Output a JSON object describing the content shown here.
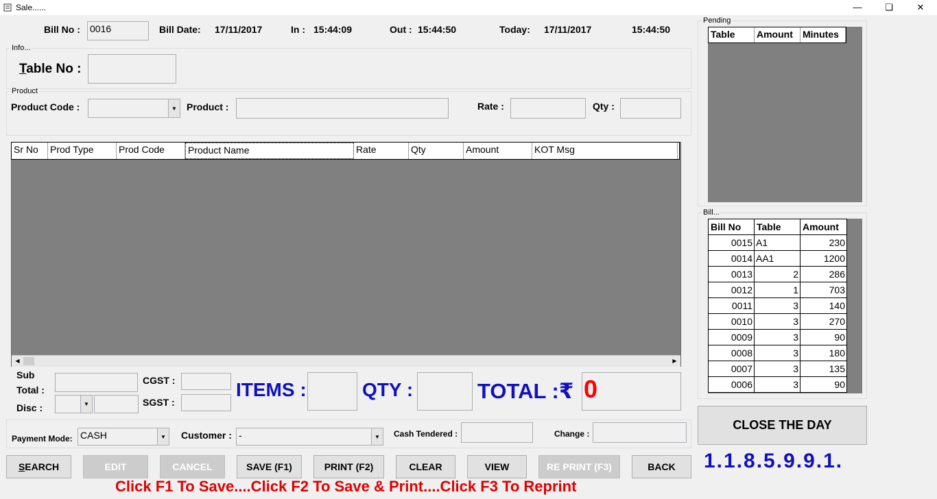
{
  "window": {
    "title": "Sale......",
    "minimize_glyph": "—",
    "restore_glyph": "❏",
    "close_glyph": "✕"
  },
  "header": {
    "bill_no_label": "Bill No :",
    "bill_no_value": "0016",
    "bill_date_label": "Bill Date:",
    "bill_date_value": "17/11/2017",
    "in_label": "In :",
    "in_value": "15:44:09",
    "out_label": "Out :",
    "out_value": "15:44:50",
    "today_label": "Today:",
    "today_value": "17/11/2017",
    "clock_value": "15:44:50"
  },
  "info": {
    "group_label": "Info...",
    "table_no_label": "Table No :",
    "table_no_value": ""
  },
  "product": {
    "group_label": "Product",
    "product_code_label": "Product Code :",
    "product_code_value": "",
    "product_label": "Product :",
    "product_value": "",
    "rate_label": "Rate :",
    "rate_value": "",
    "qty_label": "Qty :",
    "qty_value": ""
  },
  "items_grid": {
    "columns": [
      "Sr No",
      "Prod Type",
      "Prod Code",
      "Product Name",
      "Rate",
      "Qty",
      "Amount",
      "KOT Msg"
    ]
  },
  "totals": {
    "sub_total_label_1": "Sub",
    "sub_total_label_2": "Total :",
    "disc_label": "Disc :",
    "cgst_label": "CGST :",
    "sgst_label": "SGST :",
    "items_label": "ITEMS :",
    "qty_label": "QTY :",
    "total_label": "TOTAL :₹",
    "total_value": "0"
  },
  "payment": {
    "payment_mode_label": "Payment Mode:",
    "payment_mode_value": "CASH",
    "customer_label": "Customer :",
    "customer_value": "-",
    "cash_tendered_label": "Cash Tendered :",
    "change_label": "Change :"
  },
  "buttons": {
    "search": "SEARCH",
    "edit": "EDIT",
    "cancel": "CANCEL",
    "save": "SAVE (F1)",
    "print": "PRINT (F2)",
    "clear": "CLEAR",
    "view": "VIEW",
    "reprint": "RE PRINT (F3)",
    "back": "BACK"
  },
  "hint": "Click F1 To Save....Click F2 To Save & Print....Click F3 To Reprint",
  "pending": {
    "group_label": "Pending",
    "columns": [
      "Table",
      "Amount",
      "Minutes"
    ]
  },
  "bills": {
    "group_label": "Bill...",
    "columns": [
      "Bill No",
      "Table",
      "Amount"
    ],
    "rows": [
      [
        "0015",
        "A1",
        "230"
      ],
      [
        "0014",
        "AA1",
        "1200"
      ],
      [
        "0013",
        "2",
        "286"
      ],
      [
        "0012",
        "1",
        "703"
      ],
      [
        "0011",
        "3",
        "140"
      ],
      [
        "0010",
        "3",
        "270"
      ],
      [
        "0009",
        "3",
        "90"
      ],
      [
        "0008",
        "3",
        "180"
      ],
      [
        "0007",
        "3",
        "135"
      ],
      [
        "0006",
        "3",
        "90"
      ]
    ]
  },
  "close_day_label": "CLOSE THE DAY",
  "version": "1.1.8.5.9.9.1.",
  "colors": {
    "accent_blue": "#1010c0",
    "hint_red": "#e00000",
    "total_red": "#ff0000",
    "grid_gray": "#808080"
  }
}
